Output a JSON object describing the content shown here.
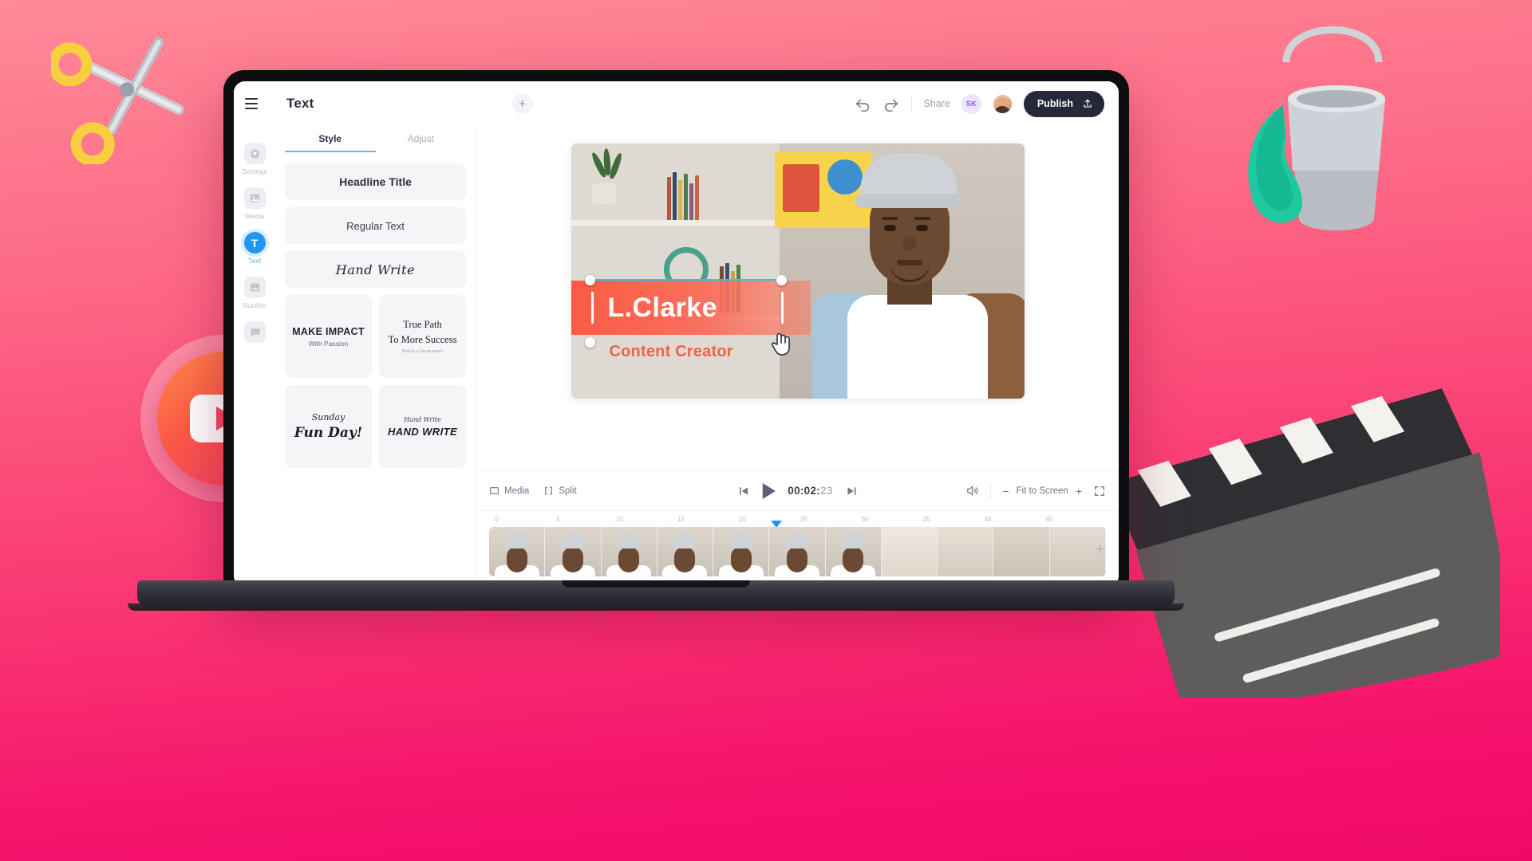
{
  "header": {
    "menu_icon": "hamburger-icon",
    "panel_title": "Text",
    "add_icon": "plus-icon",
    "undo_icon": "undo-arrow-icon",
    "redo_icon": "redo-arrow-icon",
    "share_label": "Share",
    "avatar_initials": "SK",
    "publish_label": "Publish",
    "publish_icon": "share-upload-icon"
  },
  "rail": {
    "items": [
      {
        "label": "Settings",
        "icon": "gear-icon",
        "active": false
      },
      {
        "label": "Media",
        "icon": "image-icon",
        "active": false
      },
      {
        "label": "Text",
        "icon": "text-t-icon",
        "active": true
      },
      {
        "label": "Subtitle",
        "icon": "subtitle-icon",
        "active": false
      },
      {
        "label": "",
        "icon": "chat-bubble-icon",
        "active": false
      }
    ]
  },
  "left_panel": {
    "tabs": [
      {
        "label": "Style",
        "active": true
      },
      {
        "label": "Adjust",
        "active": false
      }
    ],
    "wide_presets": [
      {
        "label": "Headline Title",
        "style": "headline"
      },
      {
        "label": "Regular Text",
        "style": "regular"
      },
      {
        "label": "Hand Write",
        "style": "script"
      }
    ],
    "card_presets": [
      {
        "line1": "MAKE IMPACT",
        "line2": "With Passion",
        "line3": "",
        "style": "impact"
      },
      {
        "line1": "True Path",
        "line2": "To More Success",
        "line3": "Watch a learn more",
        "style": "serif"
      },
      {
        "line1": "Sunday",
        "line2": "Fun Day!",
        "line3": "",
        "style": "handscript"
      },
      {
        "line1": "Hand Write",
        "line2": "HAND WRITE",
        "line3": "",
        "style": "handbold"
      }
    ]
  },
  "canvas": {
    "overlay_title": "L.Clarke",
    "overlay_subtitle": "Content Creator",
    "selection_handles": 4,
    "cursor_icon": "hand-pointer-icon",
    "accent_color": "#fb5a43",
    "selection_color": "#31c5e8"
  },
  "toolbar": {
    "media_label": "Media",
    "split_label": "Split",
    "split_icon": "split-brackets-icon",
    "media_icon": "media-stack-icon",
    "prev_frame_icon": "skip-previous-icon",
    "play_icon": "play-icon",
    "next_frame_icon": "skip-next-icon",
    "timecode_main": "00:02:",
    "timecode_frames": "23",
    "volume_icon": "volume-icon",
    "zoom_out_label": "−",
    "zoom_label": "Fit to Screen",
    "zoom_in_label": "+",
    "fullscreen_icon": "fullscreen-icon"
  },
  "timeline": {
    "ticks": [
      "0",
      "5",
      "10",
      "15",
      "20",
      "25",
      "30",
      "35",
      "40",
      "45"
    ],
    "playhead_tick": "22",
    "add_track_icon": "plus-icon",
    "frame_count": 11
  },
  "decorations": {
    "youtube_badge_icon": "youtube-play-icon",
    "scissors_icon": "scissors-icon",
    "paint_bucket_icon": "paint-bucket-icon",
    "clapperboard_icon": "clapperboard-icon"
  }
}
